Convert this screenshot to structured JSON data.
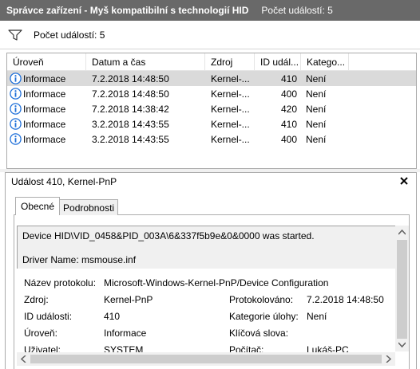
{
  "title": {
    "main": "Správce zařízení - Myš kompatibilní s technologií HID",
    "count": "Počet událostí: 5"
  },
  "filter": {
    "label": "Počet událostí: 5",
    "icon": "filter-icon"
  },
  "list": {
    "columns": [
      "Úroveň",
      "Datum a čas",
      "Zdroj",
      "ID udál...",
      "Katego..."
    ],
    "rows": [
      {
        "level": "Informace",
        "datetime": "7.2.2018 14:48:50",
        "source": "Kernel-...",
        "id": "410",
        "category": "Není",
        "selected": true
      },
      {
        "level": "Informace",
        "datetime": "7.2.2018 14:48:50",
        "source": "Kernel-...",
        "id": "400",
        "category": "Není"
      },
      {
        "level": "Informace",
        "datetime": "7.2.2018 14:38:42",
        "source": "Kernel-...",
        "id": "420",
        "category": "Není"
      },
      {
        "level": "Informace",
        "datetime": "3.2.2018 14:43:55",
        "source": "Kernel-...",
        "id": "410",
        "category": "Není"
      },
      {
        "level": "Informace",
        "datetime": "3.2.2018 14:43:55",
        "source": "Kernel-...",
        "id": "400",
        "category": "Není"
      }
    ]
  },
  "detail": {
    "header": "Událost 410, Kernel-PnP",
    "tabs": [
      "Obecné",
      "Podrobnosti"
    ],
    "message": {
      "line1": "Device HID\\VID_0458&PID_003A\\6&337f5b9e&0&0000 was started.",
      "line2": "Driver Name: msmouse.inf"
    },
    "props": [
      {
        "k1": "Název protokolu:",
        "v1": "Microsoft-Windows-Kernel-PnP/Device Configuration",
        "k2": "",
        "v2": ""
      },
      {
        "k1": "Zdroj:",
        "v1": "Kernel-PnP",
        "k2": "Protokolováno:",
        "v2": "7.2.2018 14:48:50"
      },
      {
        "k1": "ID události:",
        "v1": "410",
        "k2": "Kategorie úlohy:",
        "v2": "Není"
      },
      {
        "k1": "Úroveň:",
        "v1": "Informace",
        "k2": "Klíčová slova:",
        "v2": ""
      },
      {
        "k1": "Uživatel:",
        "v1": "SYSTEM",
        "k2": "Počítač:",
        "v2": "Lukáš-PC"
      }
    ]
  },
  "colors": {
    "titlebar": "#696969",
    "selection": "#dadada",
    "info_icon": "#1e6fd9"
  }
}
